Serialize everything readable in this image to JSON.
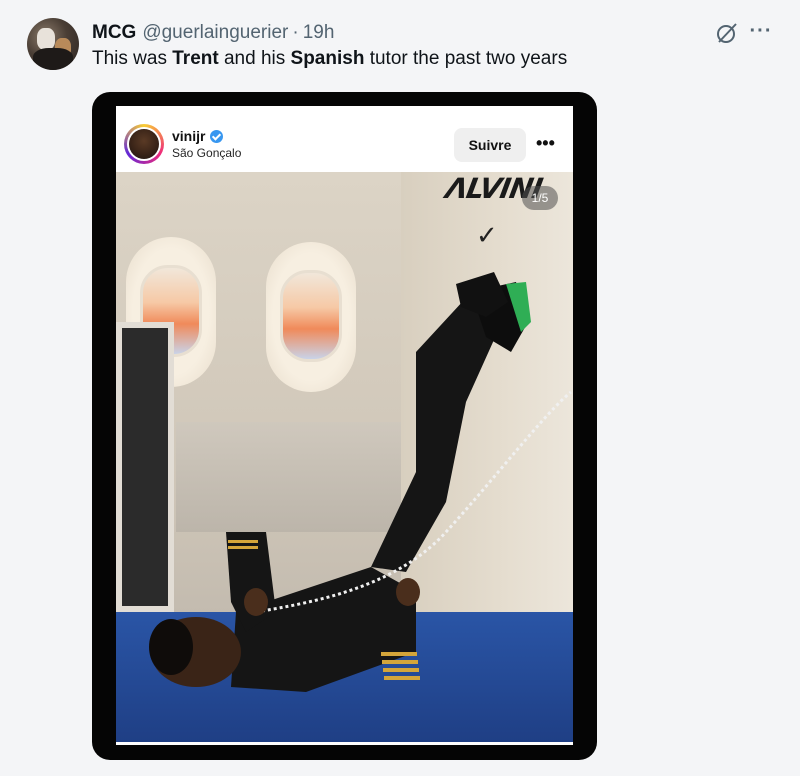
{
  "tweet": {
    "author_name": "MCG",
    "author_handle": "@guerlainguerier",
    "separator": "·",
    "time": "19h",
    "text_parts": [
      "This was ",
      "Trent",
      " and his ",
      "Spanish",
      " tutor the past two years"
    ]
  },
  "icons": {
    "grok": "grok-icon",
    "more": "more-icon"
  },
  "embedded_post": {
    "username": "vinijr",
    "location": "São Gonçalo",
    "follow_label": "Suivre",
    "more_label": "•••",
    "image_counter": "1/5",
    "brand_text": "ΛLVINI"
  },
  "colors": {
    "secondary_text": "#536471",
    "verified": "#3897f0",
    "floor": "#2a55a6"
  }
}
